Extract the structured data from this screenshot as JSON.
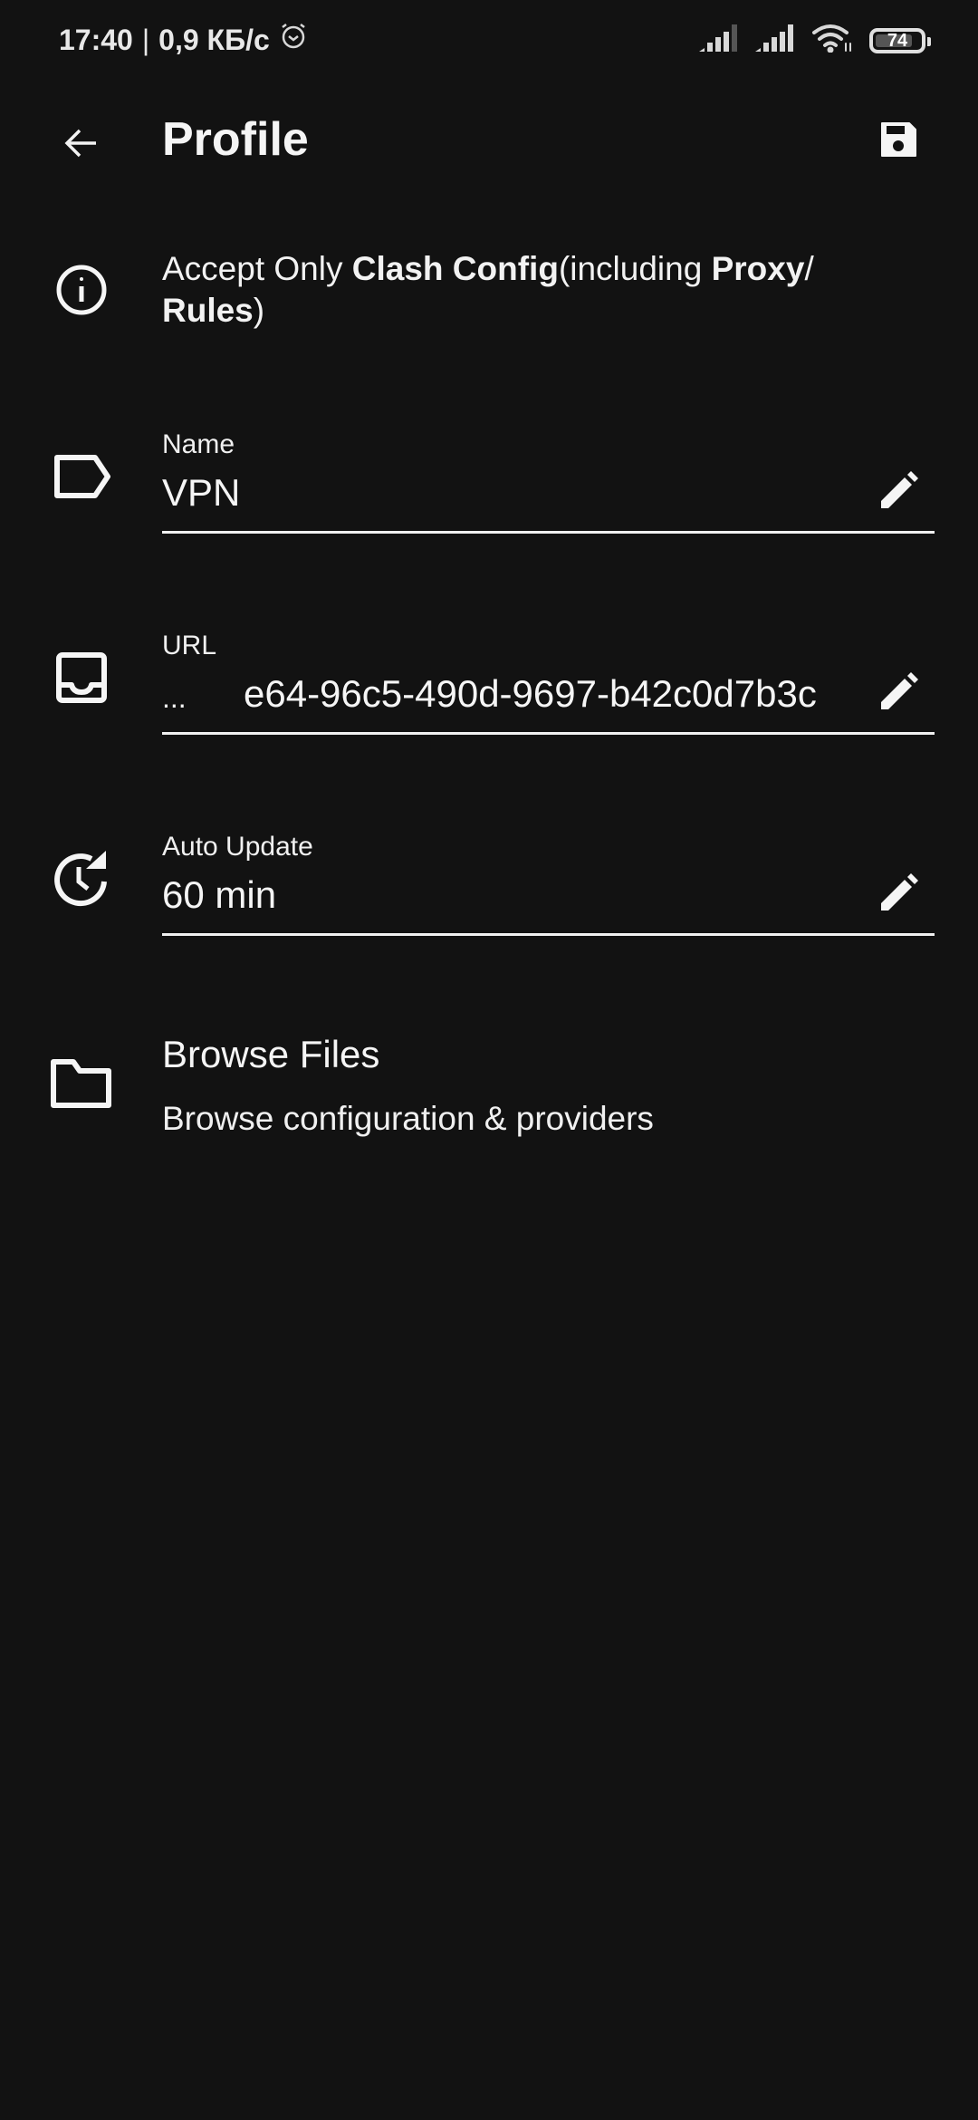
{
  "status_bar": {
    "time": "17:40",
    "separator": "|",
    "network_speed": "0,9 КБ/с",
    "alarm_icon": "alarm-clock-icon",
    "signal_icons": [
      "signal-sim1-icon",
      "signal-sim2-icon"
    ],
    "wifi_icon": "wifi-icon",
    "battery_level": "74",
    "battery_fraction": 0.74
  },
  "app_bar": {
    "back_icon": "arrow-back-icon",
    "title": "Profile",
    "save_icon": "save-floppy-icon"
  },
  "info": {
    "icon": "info-icon",
    "parts": [
      {
        "text": "Accept Only ",
        "bold": false
      },
      {
        "text": "Clash Config",
        "bold": true
      },
      {
        "text": "(including ",
        "bold": false
      },
      {
        "text": "Proxy",
        "bold": true
      },
      {
        "text": "/ ",
        "bold": false
      },
      {
        "text": "Rules",
        "bold": true
      },
      {
        "text": ")",
        "bold": false
      }
    ]
  },
  "fields": {
    "name": {
      "icon": "label-tag-icon",
      "label": "Name",
      "value": "VPN",
      "edit_icon": "pencil-edit-icon"
    },
    "url": {
      "icon": "inbox-tray-icon",
      "label": "URL",
      "ellipsis": "...",
      "value": "e64-96c5-490d-9697-b42c0d7b3c",
      "edit_icon": "pencil-edit-icon"
    },
    "auto_update": {
      "icon": "clock-refresh-icon",
      "label": "Auto Update",
      "value": "60 min",
      "edit_icon": "pencil-edit-icon"
    }
  },
  "browse_files": {
    "icon": "folder-icon",
    "title": "Browse Files",
    "subtitle": "Browse configuration & providers"
  },
  "colors": {
    "background": "#121212",
    "foreground": "#f5f5f5"
  }
}
